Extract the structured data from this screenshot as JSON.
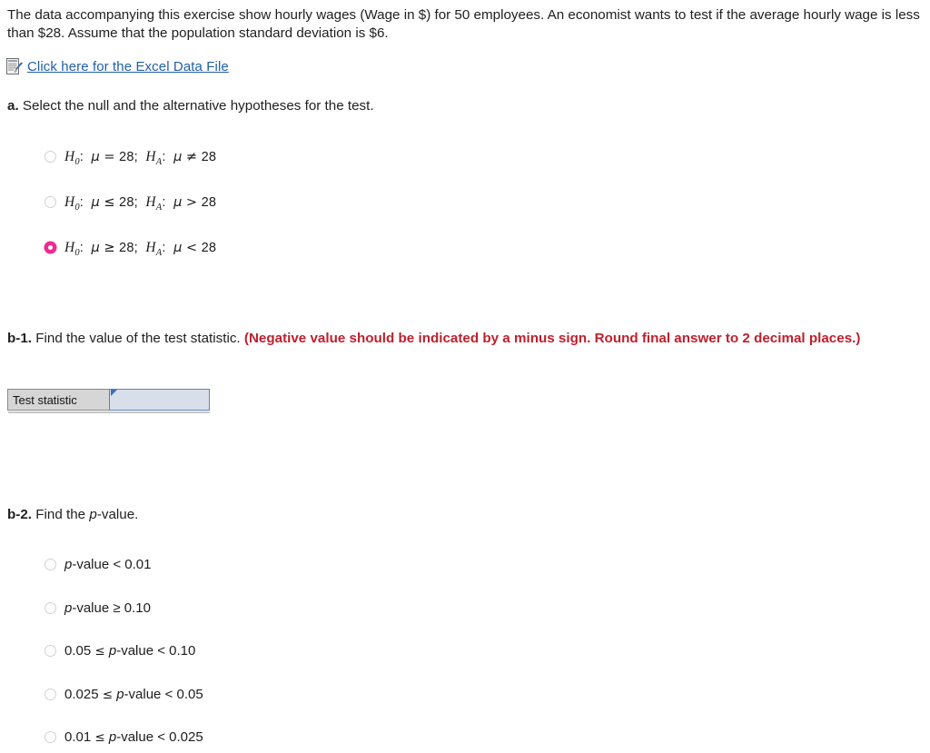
{
  "intro": {
    "text": "The data accompanying this exercise show hourly wages (Wage in $) for 50 employees. An economist wants to test if the average hourly wage is less than $28. Assume that the population standard deviation is $6."
  },
  "datafile": {
    "icon": "document-pen-icon",
    "link_text": "Click here for the Excel Data File"
  },
  "colors": {
    "link": "#1f5fa9",
    "selected_radio": "#ee2b8f",
    "warning_text": "#bf1f2c",
    "input_border": "#5b84b9",
    "input_fill": "#d8dfeb",
    "label_fill": "#d6d6d6"
  },
  "part_a": {
    "label": "a.",
    "text": "Select the null and the alternative hypotheses for the test.",
    "options": [
      {
        "id": "a-opt-1",
        "selected": false,
        "h0_sym": "H",
        "h0_sub": "0",
        "h0_rel": "=",
        "h0_val": "28",
        "ha_sym": "H",
        "ha_sub": "A",
        "ha_rel": "≠",
        "ha_val": "28",
        "mu": "μ",
        "plain": "H0: μ = 28; HA: μ ≠ 28"
      },
      {
        "id": "a-opt-2",
        "selected": false,
        "h0_sym": "H",
        "h0_sub": "0",
        "h0_rel": "≤",
        "h0_val": "28",
        "ha_sym": "H",
        "ha_sub": "A",
        "ha_rel": ">",
        "ha_val": "28",
        "mu": "μ",
        "plain": "H0: μ ≤ 28; HA: μ > 28"
      },
      {
        "id": "a-opt-3",
        "selected": true,
        "h0_sym": "H",
        "h0_sub": "0",
        "h0_rel": "≥",
        "h0_val": "28",
        "ha_sym": "H",
        "ha_sub": "A",
        "ha_rel": "<",
        "ha_val": "28",
        "mu": "μ",
        "plain": "H0: μ ≥ 28; HA: μ < 28"
      }
    ]
  },
  "part_b1": {
    "label": "b-1.",
    "text": "Find the value of the test statistic.",
    "warning": "(Negative value should be indicated by a minus sign. Round final answer to 2 decimal places.)",
    "field_label": "Test statistic",
    "field_value": "",
    "field_placeholder": ""
  },
  "part_b2": {
    "label": "b-2.",
    "text_before": "Find the ",
    "text_italic": "p",
    "text_after": "-value.",
    "options": [
      {
        "id": "b2-opt-1",
        "selected": false,
        "left": "",
        "rel": "",
        "mid": "p",
        "tail": "-value < 0.01",
        "plain": "p-value < 0.01"
      },
      {
        "id": "b2-opt-2",
        "selected": false,
        "left": "",
        "rel": "",
        "mid": "p",
        "tail": "-value ≥ 0.10",
        "plain": "p-value ≥ 0.10"
      },
      {
        "id": "b2-opt-3",
        "selected": false,
        "left": "0.05",
        "rel": "≤",
        "mid": "p",
        "tail": "-value < 0.10",
        "plain": "0.05 ≤ p-value < 0.10"
      },
      {
        "id": "b2-opt-4",
        "selected": false,
        "left": "0.025",
        "rel": "≤",
        "mid": "p",
        "tail": "-value < 0.05",
        "plain": "0.025 ≤ p-value < 0.05"
      },
      {
        "id": "b2-opt-5",
        "selected": false,
        "left": "0.01",
        "rel": "≤",
        "mid": "p",
        "tail": "-value < 0.025",
        "plain": "0.01 ≤ p-value < 0.025"
      }
    ]
  }
}
